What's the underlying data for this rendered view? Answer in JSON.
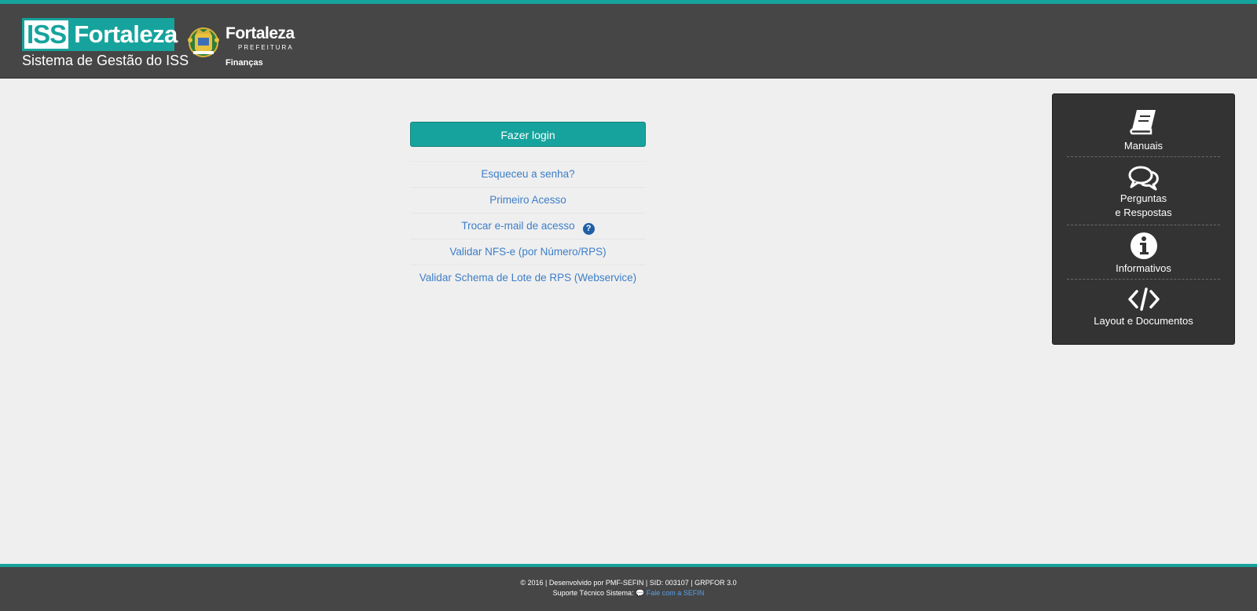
{
  "header": {
    "iss_logo": {
      "badge": "ISS",
      "name": "Fortaleza",
      "subtitle": "Sistema de Gestão do ISS"
    },
    "pref_logo": {
      "title": "Fortaleza",
      "subtitle": "PREFEITURA",
      "dept": "Finanças"
    }
  },
  "login": {
    "button_label": "Fazer login",
    "links": [
      {
        "label": "Esqueceu a senha?"
      },
      {
        "label": "Primeiro Acesso"
      },
      {
        "label": "Trocar e-mail de acesso",
        "help": "?"
      },
      {
        "label": "Validar NFS-e (por Número/RPS)"
      },
      {
        "label": "Validar Schema de Lote de RPS (Webservice)"
      }
    ]
  },
  "side_panel": {
    "items": [
      {
        "label": "Manuais",
        "icon": "book-icon"
      },
      {
        "label_line1": "Perguntas",
        "label_line2": "e Respostas",
        "icon": "comments-icon"
      },
      {
        "label": "Informativos",
        "icon": "info-icon"
      },
      {
        "label": "Layout e Documentos",
        "icon": "code-icon"
      }
    ]
  },
  "footer": {
    "line1": "© 2016 | Desenvolvido por PMF-SEFIN | SID: 003107 | GRPFOR 3.0",
    "support_label": "Suporte Técnico Sistema:",
    "support_link_icon": "💬",
    "support_link": "Fale com a SEFIN"
  },
  "colors": {
    "accent": "#17a39d",
    "header_bg": "#464646",
    "link": "#3d7ec8",
    "panel_bg": "#333333"
  }
}
